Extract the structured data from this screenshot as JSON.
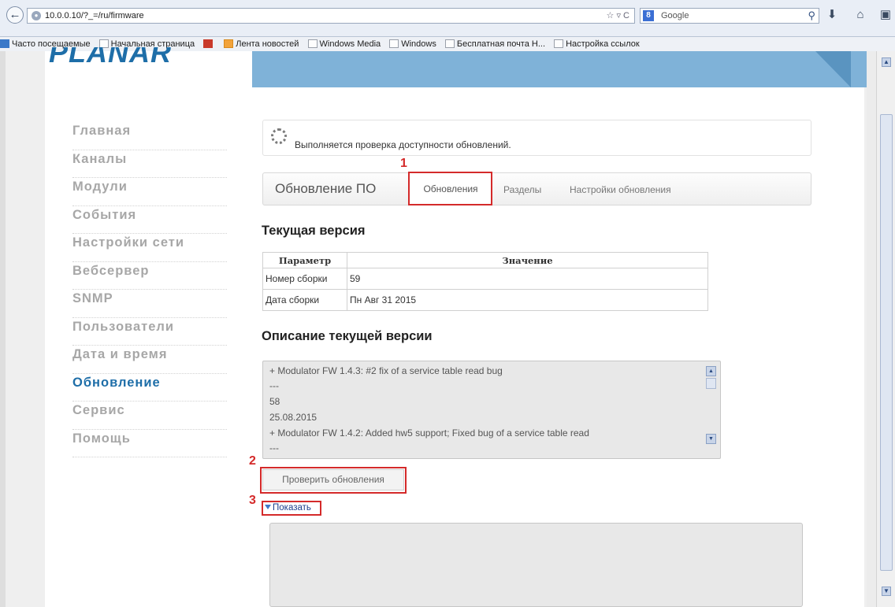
{
  "browser": {
    "url": "10.0.0.10/?_=/ru/firmware",
    "search_placeholder": "Google",
    "back_glyph": "←",
    "url_tools": "☆ ▿ C",
    "search_engine_glyph": "8",
    "magnifier_glyph": "⚲",
    "download_glyph": "⬇",
    "home_glyph": "⌂",
    "extra_glyph": "▣"
  },
  "bookmarks": [
    {
      "label": "Часто посещаемые",
      "icon": "blue"
    },
    {
      "label": "Начальная страница",
      "icon": "page"
    },
    {
      "label": "",
      "icon": "k"
    },
    {
      "label": "Лента новостей",
      "icon": "rss"
    },
    {
      "label": "Windows Media",
      "icon": "page"
    },
    {
      "label": "Windows",
      "icon": "page"
    },
    {
      "label": "Бесплатная почта Н...",
      "icon": "page"
    },
    {
      "label": "Настройка ссылок",
      "icon": "page"
    }
  ],
  "logo_text": "PLANAR",
  "menu": {
    "items": [
      {
        "label": "Главная",
        "active": false
      },
      {
        "label": "Каналы",
        "active": false
      },
      {
        "label": "Модули",
        "active": false
      },
      {
        "label": "События",
        "active": false
      },
      {
        "label": "Настройки сети",
        "active": false
      },
      {
        "label": "Вебсервер",
        "active": false
      },
      {
        "label": "SNMP",
        "active": false
      },
      {
        "label": "Пользователи",
        "active": false
      },
      {
        "label": "Дата и время",
        "active": false
      },
      {
        "label": "Обновление",
        "active": true
      },
      {
        "label": "Сервис",
        "active": false
      },
      {
        "label": "Помощь",
        "active": false
      }
    ]
  },
  "status": {
    "text": "Выполняется проверка доступности обновлений."
  },
  "tabs": {
    "title": "Обновление ПО",
    "items": [
      "Обновления",
      "Разделы",
      "Настройки обновления"
    ],
    "active": "Обновления"
  },
  "annotations": {
    "marker_1": "1",
    "marker_2": "2",
    "marker_3": "3"
  },
  "current_version": {
    "heading": "Текущая версия",
    "columns": [
      "Параметр",
      "Значение"
    ],
    "rows": [
      [
        "Номер сборки",
        "59"
      ],
      [
        "Дата сборки",
        "Пн Авг 31 2015"
      ]
    ]
  },
  "description": {
    "heading": "Описание текущей версии",
    "lines": [
      "+ Modulator FW 1.4.3: #2 fix of a service table read bug",
      "---",
      "58",
      "25.08.2015",
      "+ Modulator FW 1.4.2: Added hw5 support; Fixed bug of a service table read",
      "---"
    ]
  },
  "actions": {
    "check_updates": "Проверить обновления",
    "show": "Показать"
  },
  "colors": {
    "accent": "#1e6ea8",
    "header_band": "#7fb2d8",
    "annotation_red": "#d42a2a"
  }
}
